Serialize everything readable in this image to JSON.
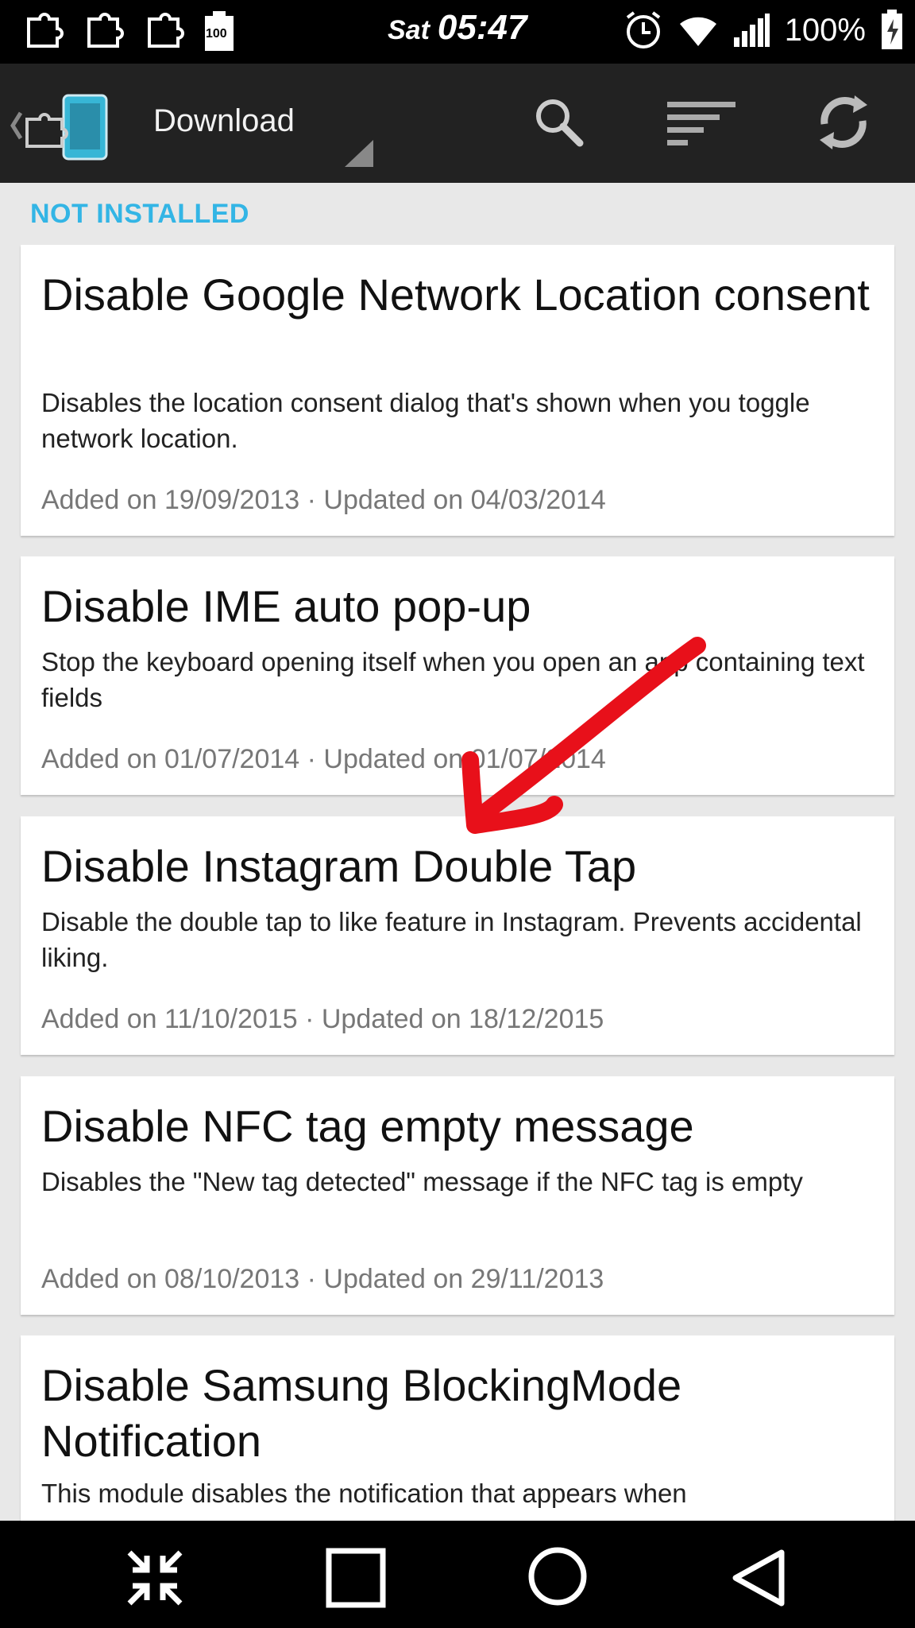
{
  "status_bar": {
    "day": "Sat",
    "time": "05:47",
    "battery_percent": "100%",
    "left_icons": [
      "puzzle-icon",
      "puzzle-icon",
      "puzzle-icon",
      "battery-100-icon"
    ],
    "notification_battery_label": "100",
    "right_icons": [
      "alarm-icon",
      "wifi-icon",
      "signal-icon",
      "battery-icon"
    ]
  },
  "action_bar": {
    "title": "Download",
    "icons": [
      "xposed-logo-icon",
      "search-icon",
      "sort-icon",
      "refresh-icon"
    ]
  },
  "section": {
    "label": "NOT INSTALLED"
  },
  "modules": [
    {
      "title": "Disable Google Network Location consent",
      "description": "Disables the location consent dialog that's shown when you toggle network location.",
      "meta": "Added on 19/09/2013 · Updated on 04/03/2014"
    },
    {
      "title": "Disable IME auto pop-up",
      "description": "Stop the keyboard opening itself when you open an app containing text fields",
      "meta": "Added on 01/07/2014 · Updated on 01/07/2014"
    },
    {
      "title": "Disable Instagram Double Tap",
      "description": "Disable the double tap to like feature in Instagram. Prevents accidental liking.",
      "meta": "Added on 11/10/2015 · Updated on 18/12/2015"
    },
    {
      "title": "Disable NFC tag empty message",
      "description": "Disables the \"New tag detected\" message if the NFC tag is empty",
      "meta": "Added on 08/10/2013 · Updated on 29/11/2013"
    },
    {
      "title": "Disable Samsung BlockingMode Notification",
      "description": "This module disables the notification that appears when"
    }
  ],
  "colors": {
    "accent": "#33b5e5",
    "annotation": "#e8101a",
    "action_bar_bg": "#222222",
    "list_bg": "#e8e8e8"
  },
  "nav_bar": {
    "icons": [
      "collapse-icon",
      "recents-icon",
      "home-icon",
      "back-icon"
    ]
  }
}
